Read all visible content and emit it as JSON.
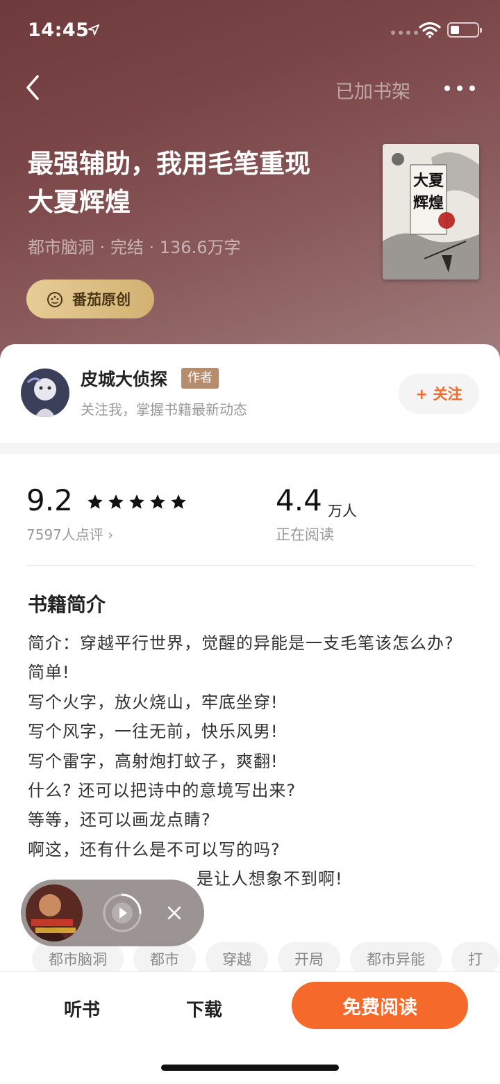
{
  "status_bar": {
    "time": "14:45"
  },
  "nav": {
    "shelf_label": "已加书架"
  },
  "book": {
    "title": "最强辅助，我用毛笔重现大夏辉煌",
    "meta": "都市脑洞 · 完结 · 136.6万字",
    "origin_badge": "番茄原创",
    "cover_text": "大夏辉煌"
  },
  "author": {
    "name": "皮城大侦探",
    "tag": "作者",
    "subtitle": "关注我，掌握书籍最新动态",
    "follow_label": "+ 关注"
  },
  "stats": {
    "score": "9.2",
    "stars": 5,
    "reviews": "7597人点评 ›",
    "reading_count": "4.4",
    "reading_unit": "万人",
    "reading_label": "正在阅读"
  },
  "intro": {
    "title": "书籍简介",
    "lines": [
      "简介：穿越平行世界，觉醒的异能是一支毛笔该怎么办?",
      "简单!",
      "写个火字，放火烧山，牢底坐穿!",
      "写个风字，一往无前，快乐风男!",
      "写个雷字，高射炮打蚊子，爽翻!",
      "什么? 还可以把诗中的意境写出来?",
      "等等，还可以画龙点睛?",
      "啊这，还有什么是不可以写的吗?",
      "是让人想象不到啊!"
    ]
  },
  "tags": [
    "都市脑洞",
    "都市",
    "穿越",
    "开局",
    "都市异能",
    "打"
  ],
  "bottom_bar": {
    "listen_label": "听书",
    "download_label": "下载",
    "read_label": "免费阅读"
  },
  "colors": {
    "accent": "#f56a2a",
    "hero_top": "#6e3a3c",
    "badge_gold": "#d9bd85",
    "author_tag": "#b58c6c"
  },
  "icons": [
    "location-arrow-icon",
    "wifi-icon",
    "battery-icon",
    "back-chevron-icon",
    "more-dots-icon",
    "tomato-badge-icon",
    "star-icon",
    "play-icon",
    "close-icon"
  ]
}
